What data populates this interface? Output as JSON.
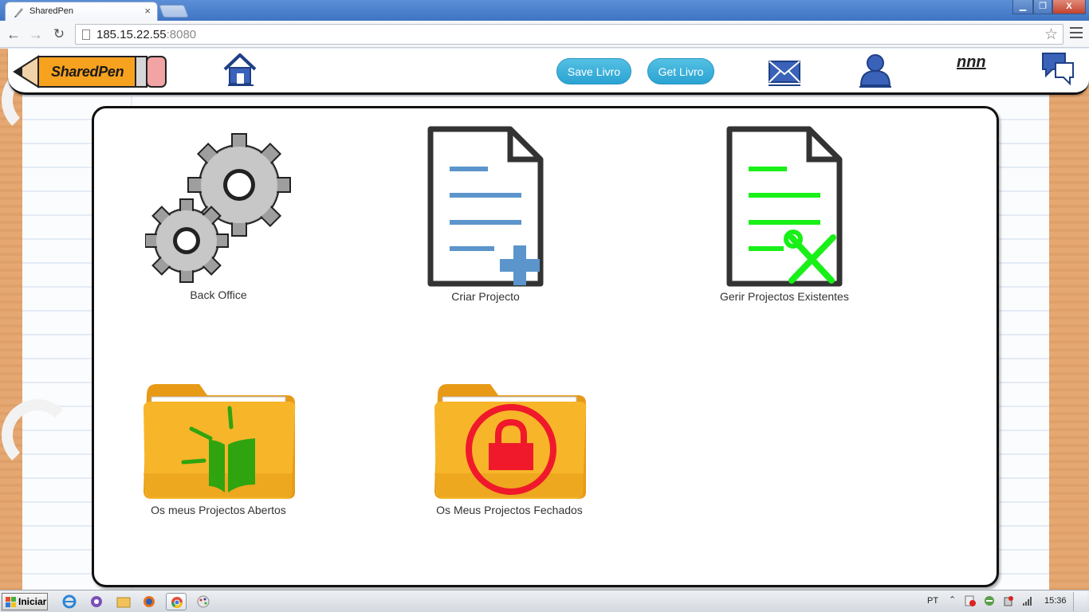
{
  "browser": {
    "tab_title": "SharedPen",
    "tab_close": "×",
    "url_host": "185.15.22.55",
    "url_port": ":8080",
    "window_controls": {
      "minimize": "▁",
      "maximize": "❐",
      "close": "X"
    }
  },
  "header": {
    "logo_text": "SharedPen",
    "save_label": "Save Livro",
    "get_label": "Get Livro",
    "username": "nnn",
    "button_color": "#2aa3d3"
  },
  "tiles": [
    {
      "label": "Back Office",
      "icon": "gears-icon"
    },
    {
      "label": "Criar Projecto",
      "icon": "new-document-icon"
    },
    {
      "label": "Gerir Projectos Existentes",
      "icon": "manage-document-icon"
    },
    {
      "label": "Os meus Projectos Abertos",
      "icon": "open-folder-book-icon"
    },
    {
      "label": "Os Meus Projectos Fechados",
      "icon": "closed-folder-lock-icon"
    }
  ],
  "taskbar": {
    "start_label": "Iniciar",
    "language": "PT",
    "tray_arrow": "⌃",
    "time": "15:36"
  }
}
